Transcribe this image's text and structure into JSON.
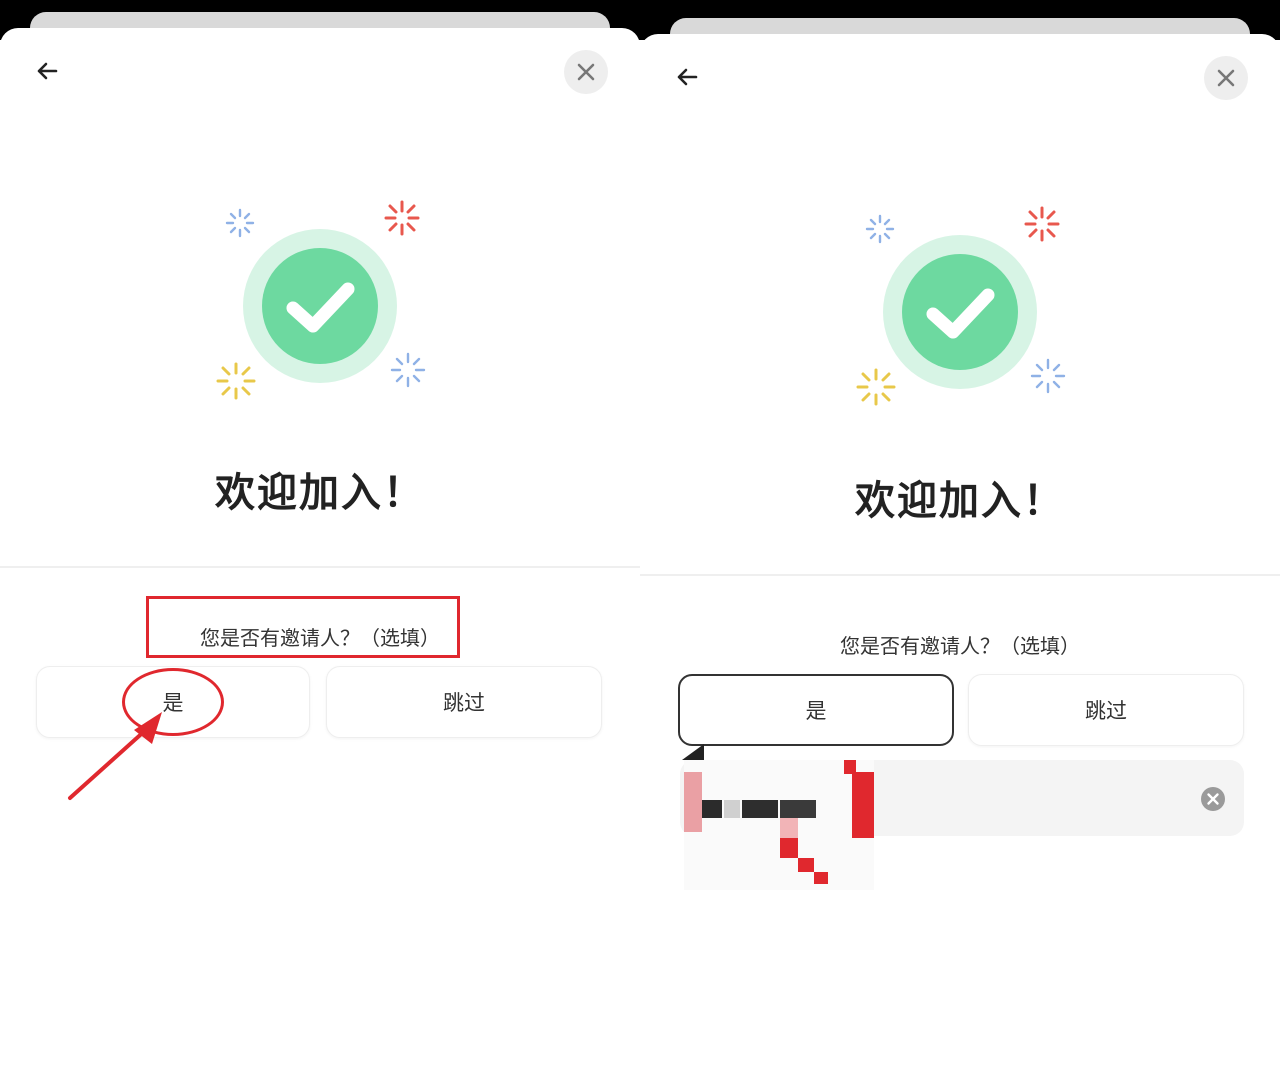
{
  "left_screen": {
    "welcome_title": "欢迎加入！",
    "inviter_question": "您是否有邀请人？（选填）",
    "yes_label": "是",
    "skip_label": "跳过"
  },
  "right_screen": {
    "welcome_title": "欢迎加入！",
    "inviter_question": "您是否有邀请人？（选填）",
    "yes_label": "是",
    "skip_label": "跳过"
  },
  "icons": {
    "back": "arrow-left-icon",
    "close": "close-icon",
    "success": "check-circle-icon",
    "clear": "clear-circle-icon"
  },
  "colors": {
    "success_green": "#6dd9a0",
    "success_halo": "#d7f4e5",
    "annotation_red": "#e0282e",
    "sparkle_red": "#e8584e",
    "sparkle_blue": "#8fb1e6",
    "sparkle_yellow": "#e8c84a"
  }
}
